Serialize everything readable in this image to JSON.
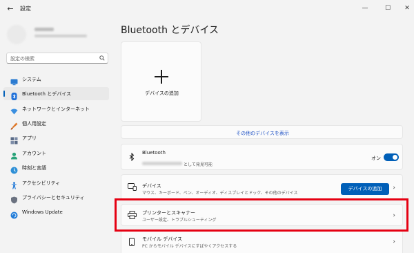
{
  "titlebar": {
    "app_title": "設定",
    "back_icon": "arrow-left-icon",
    "minimize_icon": "minimize-icon",
    "maximize_icon": "maximize-icon",
    "close_icon": "close-icon"
  },
  "search": {
    "placeholder": "設定の検索",
    "icon": "search-icon"
  },
  "sidebar": {
    "items": [
      {
        "label": "システム",
        "icon": "system-monitor-icon",
        "icon_color": "#2b7bd1",
        "active": false
      },
      {
        "label": "Bluetooth とデバイス",
        "icon": "bluetooth-icon",
        "icon_color": "#1e6fd9",
        "active": true
      },
      {
        "label": "ネットワークとインターネット",
        "icon": "network-icon",
        "icon_color": "#3a8fe0",
        "active": false
      },
      {
        "label": "個人用設定",
        "icon": "brush-icon",
        "icon_color": "#e07a2b",
        "active": false
      },
      {
        "label": "アプリ",
        "icon": "apps-icon",
        "icon_color": "#596a86",
        "active": false
      },
      {
        "label": "アカウント",
        "icon": "account-icon",
        "icon_color": "#2aa37a",
        "active": false
      },
      {
        "label": "時刻と言語",
        "icon": "time-language-icon",
        "icon_color": "#2d8fd6",
        "active": false
      },
      {
        "label": "アクセシビリティ",
        "icon": "accessibility-icon",
        "icon_color": "#1f77d6",
        "active": false
      },
      {
        "label": "プライバシーとセキュリティ",
        "icon": "shield-icon",
        "icon_color": "#6b7280",
        "active": false
      },
      {
        "label": "Windows Update",
        "icon": "windows-update-icon",
        "icon_color": "#1f7bd8",
        "active": false
      }
    ]
  },
  "main": {
    "title": "Bluetooth とデバイス",
    "add_device_tile": {
      "label": "デバイスの追加",
      "icon": "plus-icon"
    },
    "more_devices_link": "その他のデバイスを表示",
    "bluetooth": {
      "title": "Bluetooth",
      "subtitle_suffix": "として発見可能",
      "toggle_label": "オン",
      "toggle_on": true,
      "icon": "bluetooth-icon"
    },
    "devices": {
      "title": "デバイス",
      "subtitle": "マウス、キーボード、ペン、オーディオ、ディスプレイとドック、その他のデバイス",
      "button_label": "デバイスの追加",
      "icon": "devices-icon"
    },
    "printers": {
      "title": "プリンターとスキャナー",
      "subtitle": "ユーザー設定、トラブルシューティング",
      "icon": "printer-icon"
    },
    "mobile": {
      "title": "モバイル デバイス",
      "subtitle": "PC からモバイル デバイスにすばやくアクセスする",
      "icon": "phone-icon"
    }
  },
  "colors": {
    "accent": "#005fb8",
    "highlight": "#e50012"
  }
}
